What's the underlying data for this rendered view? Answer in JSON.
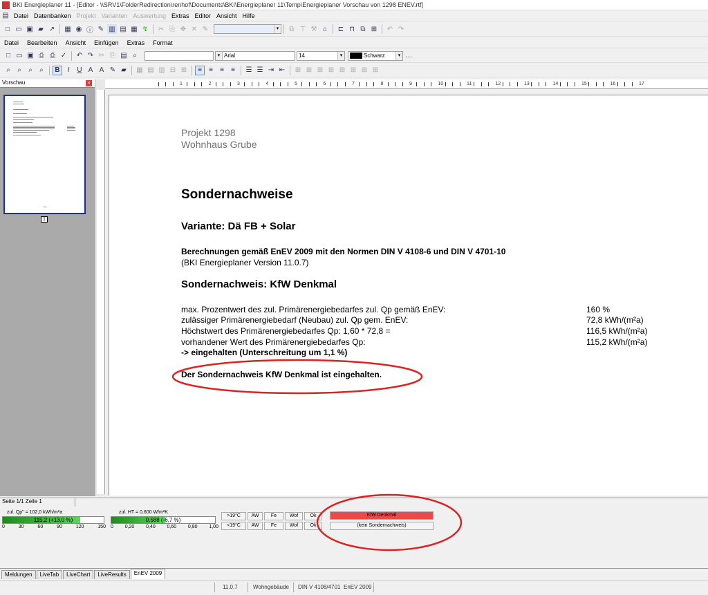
{
  "window": {
    "title": "BKI Energieplaner 11 - [Editor - \\\\SRV1\\FolderRedirection\\renhof\\Documents\\BKI\\Energieplaner 11\\Temp\\Energieplaner Vorschau von 1298 ENEV.rtf]"
  },
  "menu": [
    "Datei",
    "Datenbanken",
    "Projekt",
    "Varianten",
    "Auswertung",
    "Extras",
    "Editor",
    "Ansicht",
    "Hilfe"
  ],
  "editor_menu": [
    "Datei",
    "Bearbeiten",
    "Ansicht",
    "Einfügen",
    "Extras",
    "Format"
  ],
  "format": {
    "font": "Arial",
    "size": "14",
    "color": "Schwarz"
  },
  "preview": {
    "title": "Vorschau",
    "page_num": "1"
  },
  "ruler": [
    "1",
    "2",
    "3",
    "4",
    "5",
    "6",
    "7",
    "8",
    "9",
    "10",
    "11",
    "12",
    "13",
    "14",
    "15",
    "16",
    "17"
  ],
  "doc": {
    "project": "Projekt 1298",
    "building": "Wohnhaus Grube",
    "heading": "Sondernachweise",
    "variant": "Variante: Dä FB + Solar",
    "calc_line1": "Berechnungen gemäß EnEV 2009 mit den Normen DIN V 4108-6 und DIN V 4701-10",
    "calc_line2": "(BKI Energieplaner Version 11.0.7)",
    "sub_heading": "Sondernachweis: KfW Denkmal",
    "rows": [
      {
        "label": "max. Prozentwert des zul. Primärenergiebedarfes zul. Qp gemäß EnEV:",
        "value": "160 %"
      },
      {
        "label": "zulässiger Primärenergiebedarf (Neubau) zul. Qp gem. EnEV:",
        "value": "72,8 kWh/(m²a)"
      },
      {
        "label": "Höchstwert des Primärenergiebedarfes Qp: 1,60 * 72,8 =",
        "value": "116,5 kWh/(m²a)"
      },
      {
        "label": "vorhandener Wert des Primärenergiebedarfes Qp:",
        "value": "115,2 kWh/(m²a)"
      }
    ],
    "result": "-> eingehalten (Unterschreitung um 1,1 %)",
    "conclusion": "Der Sondernachweis KfW Denkmal ist eingehalten."
  },
  "status": {
    "page": "Seite 1/1 Zeile 1"
  },
  "energy": {
    "qp_label": "zul. Qp\" = 102,0 kWh/m²a",
    "qp_value": "115,2 (+13,0 %)",
    "qp_fill": 0.77,
    "qp_scale": [
      "0",
      "30",
      "60",
      "90",
      "120",
      "150"
    ],
    "ht_label": "zul. HT = 0,600 W/m²K",
    "ht_value": "0,588 (-6,7 %)",
    "ht_fill": 0.52,
    "ht_scale": [
      "0",
      "0,20",
      "0,40",
      "0,60",
      "0,80",
      "1,00"
    ],
    "row1": [
      ">19°C",
      "AW",
      "Fe",
      "Wof",
      "Ok"
    ],
    "row2": [
      "<19°C",
      "AW",
      "Fe",
      "Wof",
      "Ok"
    ],
    "nachweis1": "KfW Denkmal",
    "nachweis2": "(kein Sondernachweis)",
    "highlight": "#f04848"
  },
  "tabs": [
    "Meldungen",
    "LiveTab",
    "LiveChart",
    "LiveResults",
    "EnEV 2009"
  ],
  "bottom": [
    "11.0.7",
    "Wohngebäude",
    "DIN V 4108/4701",
    "EnEV 2009"
  ]
}
